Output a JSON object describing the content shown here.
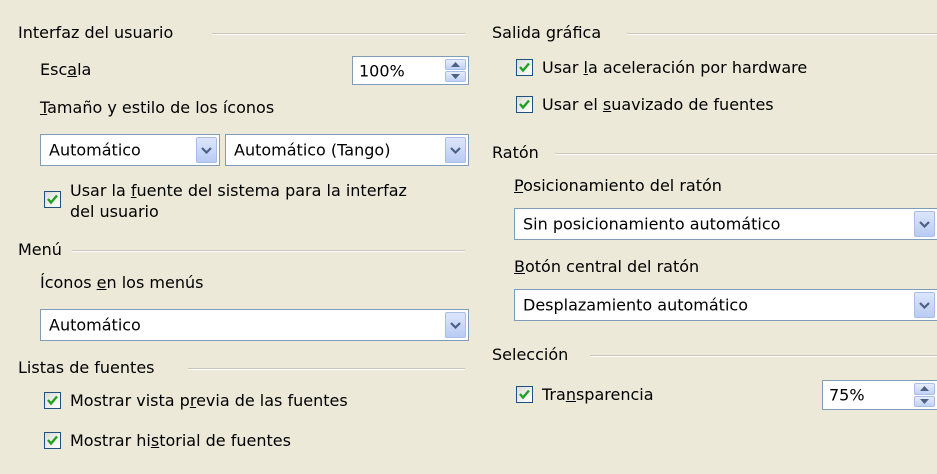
{
  "left": {
    "ui": {
      "title": "Interfaz del usuario",
      "scale_label_pre": "Esc",
      "scale_label_u": "a",
      "scale_label_post": "la",
      "scale_value": "100%",
      "icon_size_label_u": "T",
      "icon_size_label_rest": "amaño y estilo de los íconos",
      "icon_size_value": "Automático",
      "icon_style_value": "Automático (Tango)",
      "system_font_pre": "Usar la ",
      "system_font_u": "f",
      "system_font_post": "uente del sistema para la interfaz",
      "system_font_line2": "del usuario",
      "system_font_checked": true
    },
    "menu": {
      "title": "Menú",
      "icons_label_pre": "Íconos ",
      "icons_label_u": "e",
      "icons_label_post": "n los menús",
      "icons_value": "Automático"
    },
    "font_lists": {
      "title": "Listas de fuentes",
      "preview_pre": "Mostrar vista p",
      "preview_u": "r",
      "preview_post": "evia de las fuentes",
      "preview_checked": true,
      "history_pre": "Mostrar hi",
      "history_u": "s",
      "history_post": "torial de fuentes",
      "history_checked": true
    }
  },
  "right": {
    "graphics": {
      "title": "Salida gráfica",
      "hw_pre": "Usar ",
      "hw_u": "l",
      "hw_post": "a aceleración por hardware",
      "hw_checked": true,
      "aa_pre": "Usar el ",
      "aa_u": "s",
      "aa_post": "uavizado de fuentes",
      "aa_checked": true
    },
    "mouse": {
      "title": "Ratón",
      "positioning_label_u": "P",
      "positioning_label_rest": "osicionamiento del ratón",
      "positioning_value": "Sin posicionamiento automático",
      "middle_label_u": "B",
      "middle_label_rest": "otón central del ratón",
      "middle_value": "Desplazamiento automático"
    },
    "selection": {
      "title": "Selección",
      "transp_pre": "Tra",
      "transp_u": "n",
      "transp_post": "sparencia",
      "transp_checked": true,
      "transp_value": "75%"
    }
  },
  "icons": {
    "dropdown": "chevron-down-icon",
    "spinner": "spin-up-down-icon",
    "check": "checkmark-icon"
  },
  "colors": {
    "background": "#ece9d8",
    "field_border": "#7f9db9",
    "check_mark": "#21a121"
  }
}
